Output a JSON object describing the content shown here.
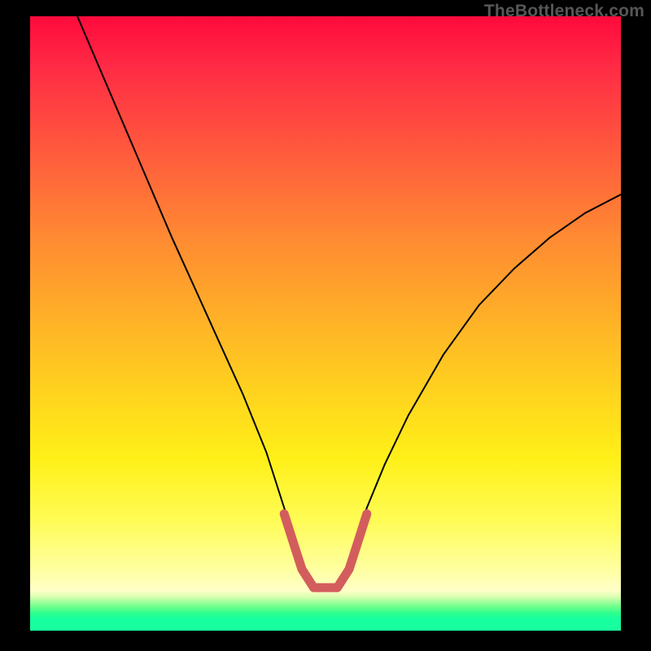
{
  "watermark": "TheBottleneck.com",
  "chart_data": {
    "type": "line",
    "title": "",
    "xlabel": "",
    "ylabel": "",
    "xlim": [
      0,
      100
    ],
    "ylim": [
      0,
      100
    ],
    "grid": false,
    "series": [
      {
        "name": "bottleneck-curve",
        "color": "#000000",
        "x": [
          8,
          12,
          16,
          20,
          24,
          28,
          32,
          36,
          40,
          43,
          45,
          46,
          48,
          52,
          54,
          55,
          57,
          60,
          64,
          70,
          76,
          82,
          88,
          94,
          100
        ],
        "values": [
          100,
          91,
          82,
          73,
          64,
          55.5,
          47,
          38.5,
          29,
          20,
          14,
          11,
          7.5,
          7.5,
          11,
          14,
          20,
          27,
          35,
          45,
          53,
          59,
          64,
          68,
          71
        ]
      },
      {
        "name": "optimum-marker",
        "color": "#d35d5d",
        "x": [
          43,
          45,
          46,
          48,
          52,
          54,
          55,
          57
        ],
        "values": [
          19,
          13,
          10,
          7,
          7,
          10,
          13,
          19
        ]
      }
    ],
    "background_gradient": {
      "type": "vertical",
      "stops": [
        {
          "pos": 0.0,
          "color": "#ff0a3c"
        },
        {
          "pos": 0.5,
          "color": "#ffb327"
        },
        {
          "pos": 0.82,
          "color": "#fffc55"
        },
        {
          "pos": 0.95,
          "color": "#73ff8e"
        },
        {
          "pos": 1.0,
          "color": "#18ffa0"
        }
      ]
    }
  }
}
